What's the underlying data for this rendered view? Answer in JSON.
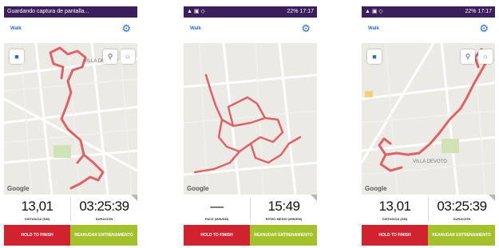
{
  "screens": [
    {
      "status": {
        "left": "Guardando captura de pantalla...",
        "right": ""
      },
      "app_title": "Walk",
      "map_labels": [
        "VILLA DEVOTO"
      ],
      "google": "Google",
      "stat_left": {
        "value": "13,01",
        "label": "DISTANCIA (KM)"
      },
      "stat_right": {
        "value": "03:25:39",
        "label": "DURACIÓN"
      },
      "finish_label": "HOLD TO FINISH",
      "resume_label": "REANUDAR ENTRENAMIENTO"
    },
    {
      "status": {
        "left": "",
        "right": "22% 17:17"
      },
      "app_title": "Walk",
      "map_labels": [],
      "google": "Google",
      "stat_left": {
        "value": "—",
        "label": "PACE (MIN/KM)"
      },
      "stat_right": {
        "value": "15:49",
        "label": "RITMO MEDIO (MIN/KM)"
      },
      "finish_label": "HOLD TO FINISH",
      "resume_label": "REANUDAR ENTRENAMIENTO"
    },
    {
      "status": {
        "left": "",
        "right": "22% 17:17"
      },
      "app_title": "Walk",
      "map_labels": [
        "VILLA DEVOTO"
      ],
      "google": "Google",
      "stat_left": {
        "value": "13,01",
        "label": "DISTANCIA (KM)"
      },
      "stat_right": {
        "value": "03:25:39",
        "label": "DURACIÓN"
      },
      "finish_label": "HOLD TO FINISH",
      "resume_label": "REANUDAR ENTRENAMIENTO"
    }
  ],
  "colors": {
    "status_bar": "#3b1f5c",
    "accent_blue": "#2b6fc9",
    "route": "#e0606a",
    "map_bg": "#eceae5",
    "finish_red": "#d0232f",
    "resume_green": "#a3c12a"
  },
  "icons": [
    "gear-icon",
    "camera-icon",
    "map-pin-icon",
    "circle-icon"
  ]
}
